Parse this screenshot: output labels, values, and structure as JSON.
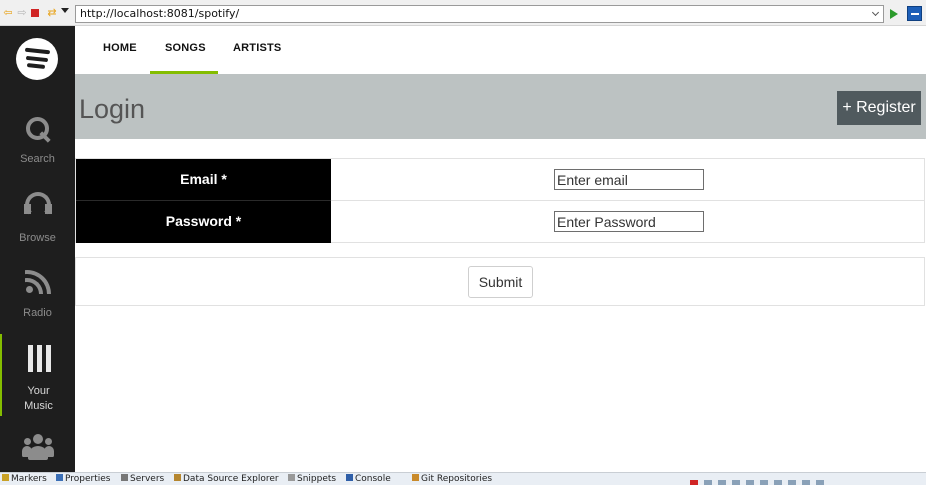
{
  "browser": {
    "url": "http://localhost:8081/spotify/"
  },
  "sidebar": {
    "items": [
      {
        "label": "Search",
        "icon": "search-icon"
      },
      {
        "label": "Browse",
        "icon": "headphones-icon"
      },
      {
        "label": "Radio",
        "icon": "radio-icon"
      },
      {
        "label_line1": "Your",
        "label_line2": "Music",
        "icon": "library-icon"
      },
      {
        "label": "",
        "icon": "users-icon"
      }
    ]
  },
  "nav": {
    "tabs": [
      "HOME",
      "SONGS",
      "ARTISTS"
    ],
    "active_tab": "SONGS",
    "accent_color": "#84bd00"
  },
  "header": {
    "title": "Login",
    "register_label": "+ Register"
  },
  "form": {
    "email_label": "Email *",
    "email_placeholder": "Enter email",
    "password_label": "Password *",
    "password_placeholder": "Enter Password",
    "submit_label": "Submit"
  },
  "bottom_bar": {
    "tabs": [
      "Markers",
      "Properties",
      "Servers",
      "Data Source Explorer",
      "Snippets",
      "Console",
      "Git Repositories"
    ]
  }
}
